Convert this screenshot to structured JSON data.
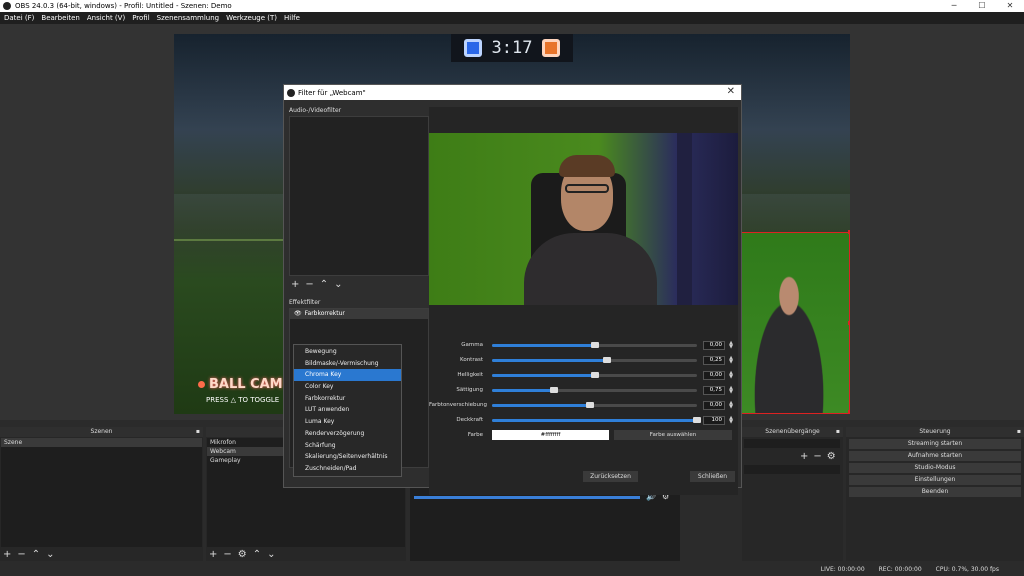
{
  "window": {
    "title": "OBS 24.0.3 (64-bit, windows) - Profil: Untitled - Szenen: Demo"
  },
  "menu": [
    "Datei (F)",
    "Bearbeiten",
    "Ansicht (V)",
    "Profil",
    "Szenensammlung",
    "Werkzeuge (T)",
    "Hilfe"
  ],
  "scene_overlay": {
    "score_time": "3:17",
    "ball_cam": "BALL CAM",
    "toggle": "PRESS △ TO TOGGLE"
  },
  "docks": {
    "scenes": {
      "title": "Szenen",
      "items": [
        "Szene"
      ]
    },
    "sources": {
      "items": [
        "Mikrofon",
        "Webcam",
        "Gameplay"
      ],
      "selected": "Webcam"
    },
    "transitions": {
      "title": "Szenenübergänge"
    },
    "controls": {
      "title": "Steuerung",
      "buttons": [
        "Streaming starten",
        "Aufnahme starten",
        "Studio-Modus",
        "Einstellungen",
        "Beenden"
      ]
    }
  },
  "status": {
    "live": "LIVE: 00:00:00",
    "rec": "REC: 00:00:00",
    "cpu": "CPU: 0.7%, 30.00 fps"
  },
  "dialog": {
    "title": "Filter für „Webcam\"",
    "audio_video_label": "Audio-/Videofilter",
    "effect_label": "Effektfilter",
    "effect_items": [
      "Farbkorrektur"
    ],
    "params": [
      {
        "label": "Gamma",
        "value": "0,00",
        "fraction": 0.5
      },
      {
        "label": "Kontrast",
        "value": "0,25",
        "fraction": 0.56
      },
      {
        "label": "Helligkeit",
        "value": "0,00",
        "fraction": 0.5
      },
      {
        "label": "Sättigung",
        "value": "0,75",
        "fraction": 0.3
      },
      {
        "label": "Farbtonverschiebung",
        "value": "0,00",
        "fraction": 0.48
      },
      {
        "label": "Deckkraft",
        "value": "100",
        "fraction": 1.0
      }
    ],
    "color_label": "Farbe",
    "color_value": "#ffffffff",
    "choose_color": "Farbe auswählen",
    "reset_button": "Zurücksetzen",
    "close_button": "Schließen"
  },
  "context_menu": {
    "items": [
      "Bewegung",
      "Bildmaske/-Vermischung",
      "Chroma Key",
      "Color Key",
      "Farbkorrektur",
      "LUT anwenden",
      "Luma Key",
      "Renderverzögerung",
      "Schärfung",
      "Skalierung/Seitenverhältnis",
      "Zuschneiden/Pad"
    ],
    "highlighted": "Chroma Key"
  },
  "colors": {
    "accent": "#2f7fd8",
    "highlight": "#2a78d0",
    "selection_red": "#dd2222"
  }
}
